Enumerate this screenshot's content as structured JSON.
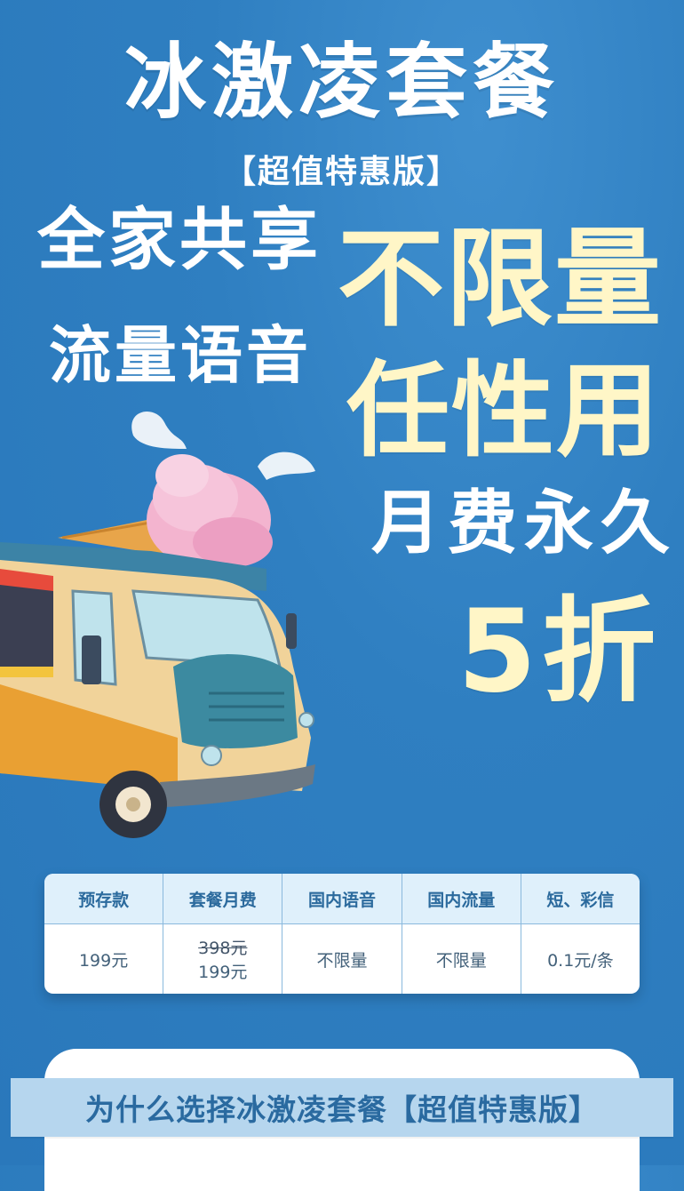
{
  "header": {
    "title": "冰激凌套餐",
    "subtitle": "【超值特惠版】"
  },
  "slogans": {
    "line1_a": "全家共享",
    "line1_b": "不限量",
    "line2_a": "流量语音",
    "line2_b": "任性用",
    "line3_a": "月费永久",
    "line3_b": "5折"
  },
  "illustration": {
    "icon": "ice-cream-truck-icon"
  },
  "plan_table": {
    "headers": [
      "预存款",
      "套餐月费",
      "国内语音",
      "国内流量",
      "短、彩信"
    ],
    "deposit": "199元",
    "monthly_fee_original": "398元",
    "monthly_fee_now": "199元",
    "voice": "不限量",
    "data": "不限量",
    "sms": "0.1元/条"
  },
  "why_section": {
    "title": "为什么选择冰激凌套餐【超值特惠版】"
  },
  "colors": {
    "background": "#2f7fc1",
    "accent_cream": "#fff6c7",
    "table_header": "#dff0fb",
    "ribbon": "#b6d6ee"
  }
}
